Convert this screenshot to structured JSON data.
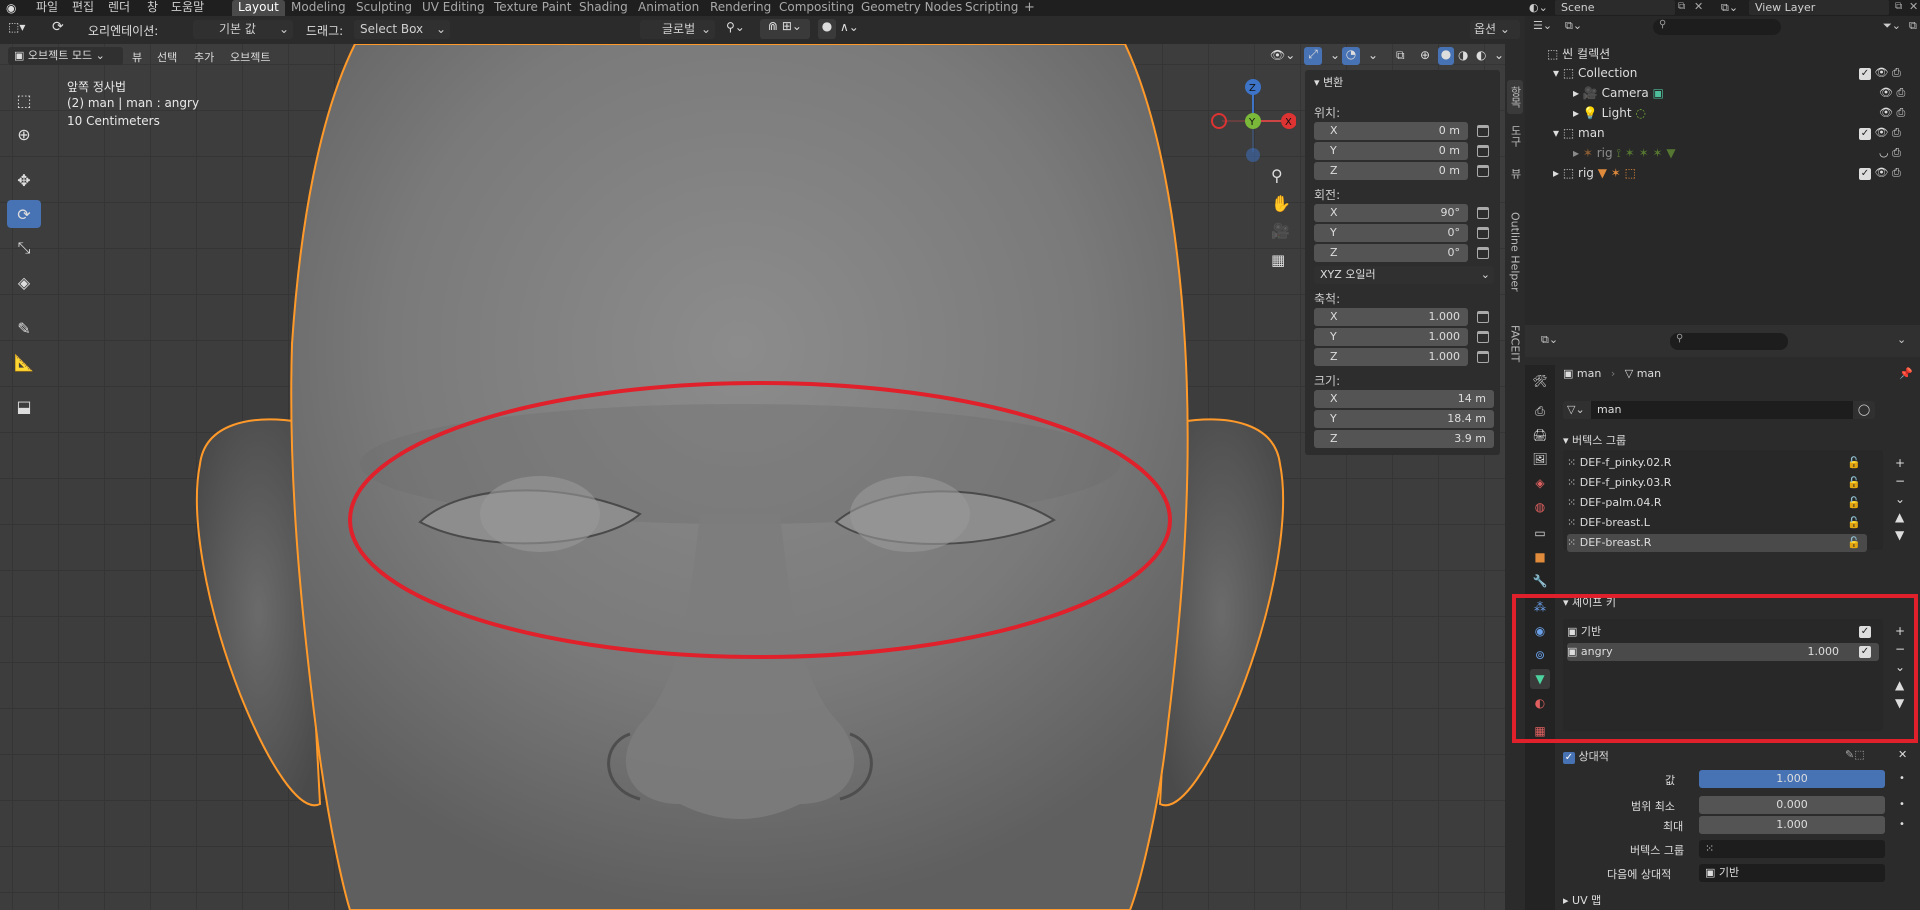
{
  "menu": {
    "file": "파일",
    "edit": "편집",
    "render": "렌더",
    "window": "창",
    "help": "도움말"
  },
  "workspaces": [
    "Layout",
    "Modeling",
    "Sculpting",
    "UV Editing",
    "Texture Paint",
    "Shading",
    "Animation",
    "Rendering",
    "Compositing",
    "Geometry Nodes",
    "Scripting"
  ],
  "header": {
    "orientation_label": "오리엔테이션:",
    "orientation_value": "기본 값",
    "drag_label": "드래그:",
    "drag_value": "Select Box",
    "transform_orientation": "글로벌",
    "options": "옵션"
  },
  "viewport_header": {
    "mode": "오브젝트 모드",
    "view": "뷰",
    "select": "선택",
    "add": "추가",
    "object": "오브젝트"
  },
  "viewport_info": {
    "line1": "앞쪽 정사법",
    "line2": "(2) man | man : angry",
    "line3": "10 Centimeters"
  },
  "npanel": {
    "title": "변환",
    "location_label": "위치:",
    "location": [
      {
        "a": "X",
        "v": "0 m"
      },
      {
        "a": "Y",
        "v": "0 m"
      },
      {
        "a": "Z",
        "v": "0 m"
      }
    ],
    "rotation_label": "회전:",
    "rotation": [
      {
        "a": "X",
        "v": "90°"
      },
      {
        "a": "Y",
        "v": "0°"
      },
      {
        "a": "Z",
        "v": "0°"
      }
    ],
    "rotation_mode": "XYZ 오일러",
    "scale_label": "축척:",
    "scale": [
      {
        "a": "X",
        "v": "1.000"
      },
      {
        "a": "Y",
        "v": "1.000"
      },
      {
        "a": "Z",
        "v": "1.000"
      }
    ],
    "dimensions_label": "크기:",
    "dimensions": [
      {
        "a": "X",
        "v": "14 m"
      },
      {
        "a": "Y",
        "v": "18.4 m"
      },
      {
        "a": "Z",
        "v": "3.9 m"
      }
    ]
  },
  "vtabs": [
    "항목",
    "도구",
    "뷰",
    "Outline Helper",
    "FACEIT"
  ],
  "scene": {
    "name": "Scene",
    "view_layer": "View Layer"
  },
  "outliner": {
    "root": "씬 컬렉션",
    "items": [
      {
        "name": "Collection"
      },
      {
        "name": "Camera"
      },
      {
        "name": "Light"
      },
      {
        "name": "man"
      },
      {
        "name": "rig"
      },
      {
        "name": "rig"
      }
    ]
  },
  "properties": {
    "breadcrumb_obj": "man",
    "breadcrumb_data": "man",
    "mesh_name": "man",
    "vertex_groups_title": "버텍스 그룹",
    "vertex_groups": [
      "DEF-f_pinky.02.R",
      "DEF-f_pinky.03.R",
      "DEF-palm.04.R",
      "DEF-breast.L",
      "DEF-breast.R"
    ],
    "shape_keys_title": "셰이프 키",
    "shape_keys": [
      {
        "name": "기반",
        "value": ""
      },
      {
        "name": "angry",
        "value": "1.000"
      }
    ],
    "relative_label": "상대적",
    "value_label": "값",
    "value": "1.000",
    "range_min_label": "범위 최소",
    "range_min": "0.000",
    "max_label": "최대",
    "max": "1.000",
    "vertex_group_label": "버텍스 그룹",
    "relative_to_label": "다음에 상대적",
    "relative_to": "기반",
    "uv_maps_title": "UV 맵"
  },
  "colors": {
    "accent": "#4772b3",
    "selection_outline": "#ff9a2a",
    "annotation": "#e0202a"
  }
}
